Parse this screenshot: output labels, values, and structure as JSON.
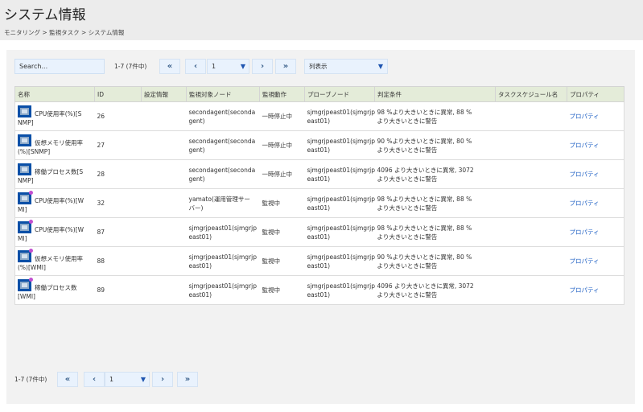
{
  "header": {
    "title": "システム情報",
    "breadcrumb": [
      "モニタリング",
      "監視タスク",
      "システム情報"
    ],
    "breadcrumb_sep": ">"
  },
  "toolbar": {
    "search_placeholder": "Search...",
    "count": "1-7 (7件中)",
    "first_label": "«",
    "prev_label": "‹",
    "page_value": "1",
    "next_label": "›",
    "last_label": "»",
    "columns_label": "列表示",
    "dropdown_arrow": "▼"
  },
  "table": {
    "columns": [
      "名称",
      "ID",
      "設定情報",
      "監視対象ノード",
      "監視動作",
      "プローブノード",
      "判定条件",
      "タスクスケジュール名",
      "プロパティ"
    ],
    "rows": [
      {
        "name_line1": "CPU使用率(%)[S",
        "name_line2": "NMP]",
        "id": "26",
        "settings": "",
        "target_line1": "secondagent(seconda",
        "target_line2": "gent)",
        "action": "一時停止中",
        "probe_line1": "sjmgrjpeast01(sjmgrjp",
        "probe_line2": "east01)",
        "cond_line1": "98 %より大きいときに異常, 88 %",
        "cond_line2": "より大きいときに警告",
        "schedule": "",
        "property": "プロパティ",
        "badge": false
      },
      {
        "name_line1": "仮想メモリ使用率",
        "name_line2": "(%)[SNMP]",
        "id": "27",
        "settings": "",
        "target_line1": "secondagent(seconda",
        "target_line2": "gent)",
        "action": "一時停止中",
        "probe_line1": "sjmgrjpeast01(sjmgrjp",
        "probe_line2": "east01)",
        "cond_line1": "90 %より大きいときに異常, 80 %",
        "cond_line2": "より大きいときに警告",
        "schedule": "",
        "property": "プロパティ",
        "badge": false
      },
      {
        "name_line1": "稼働プロセス数[S",
        "name_line2": "NMP]",
        "id": "28",
        "settings": "",
        "target_line1": "secondagent(seconda",
        "target_line2": "gent)",
        "action": "一時停止中",
        "probe_line1": "sjmgrjpeast01(sjmgrjp",
        "probe_line2": "east01)",
        "cond_line1": "4096 より大きいときに異常, 3072",
        "cond_line2": "より大きいときに警告",
        "schedule": "",
        "property": "プロパティ",
        "badge": false
      },
      {
        "name_line1": "CPU使用率(%)[W",
        "name_line2": "MI]",
        "id": "32",
        "settings": "",
        "target_line1": "yamato(運用管理サー",
        "target_line2": "バー)",
        "action": "監視中",
        "probe_line1": "sjmgrjpeast01(sjmgrjp",
        "probe_line2": "east01)",
        "cond_line1": "98 %より大きいときに異常, 88 %",
        "cond_line2": "より大きいときに警告",
        "schedule": "",
        "property": "プロパティ",
        "badge": true
      },
      {
        "name_line1": "CPU使用率(%)[W",
        "name_line2": "MI]",
        "id": "87",
        "settings": "",
        "target_line1": "sjmgrjpeast01(sjmgrjp",
        "target_line2": "east01)",
        "action": "監視中",
        "probe_line1": "sjmgrjpeast01(sjmgrjp",
        "probe_line2": "east01)",
        "cond_line1": "98 %より大きいときに異常, 88 %",
        "cond_line2": "より大きいときに警告",
        "schedule": "",
        "property": "プロパティ",
        "badge": true
      },
      {
        "name_line1": "仮想メモリ使用率",
        "name_line2": "(%)[WMI]",
        "id": "88",
        "settings": "",
        "target_line1": "sjmgrjpeast01(sjmgrjp",
        "target_line2": "east01)",
        "action": "監視中",
        "probe_line1": "sjmgrjpeast01(sjmgrjp",
        "probe_line2": "east01)",
        "cond_line1": "90 %より大きいときに異常, 80 %",
        "cond_line2": "より大きいときに警告",
        "schedule": "",
        "property": "プロパティ",
        "badge": true
      },
      {
        "name_line1": "稼働プロセス数",
        "name_line2": "[WMI]",
        "id": "89",
        "settings": "",
        "target_line1": "sjmgrjpeast01(sjmgrjp",
        "target_line2": "east01)",
        "action": "監視中",
        "probe_line1": "sjmgrjpeast01(sjmgrjp",
        "probe_line2": "east01)",
        "cond_line1": "4096 より大きいときに異常, 3072",
        "cond_line2": "より大きいときに警告",
        "schedule": "",
        "property": "プロパティ",
        "badge": true
      }
    ]
  },
  "footer": {
    "count": "1-7 (7件中)",
    "first_label": "«",
    "prev_label": "‹",
    "page_value": "1",
    "next_label": "›",
    "last_label": "»",
    "dropdown_arrow": "▼"
  },
  "colors": {
    "header_bg": "#ececec",
    "panel_bg": "#f2f2f2",
    "table_header_bg": "#e4ecd9",
    "control_bg": "#e9f2fd",
    "link": "#1f60c4",
    "icon_blue": "#0a4fa7",
    "icon_badge": "#c24fd0"
  },
  "icons": {
    "monitor_icon": "monitor-task-icon",
    "badge": "active-badge-dot"
  }
}
